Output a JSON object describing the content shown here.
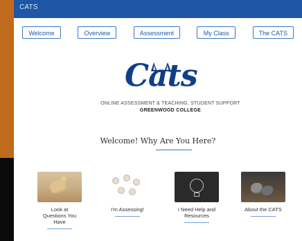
{
  "browser": {
    "title": "CATS"
  },
  "nav": {
    "items": [
      "Welcome",
      "Overview",
      "Assessment",
      "My Class",
      "The CATS"
    ]
  },
  "logo": {
    "text": "Cats",
    "subtitle": "ONLINE ASSESSMENT & TEACHING, STUDENT SUPPORT",
    "college": "GREENWOOD COLLEGE"
  },
  "welcome": {
    "heading": "Welcome! Why Are You Here?"
  },
  "cards": [
    {
      "icon": "posing-figure-icon",
      "caption": "Look at Questions You Have"
    },
    {
      "icon": "network-icon",
      "caption": "I'm Assessing!"
    },
    {
      "icon": "lightbulb-icon",
      "caption": "I Need Help and Resources"
    },
    {
      "icon": "kittens-icon",
      "caption": "About the CATS"
    }
  ],
  "colors": {
    "brand_blue": "#1f57a6",
    "logo_blue": "#0f3f86",
    "backdrop_orange": "#c06a1e"
  }
}
